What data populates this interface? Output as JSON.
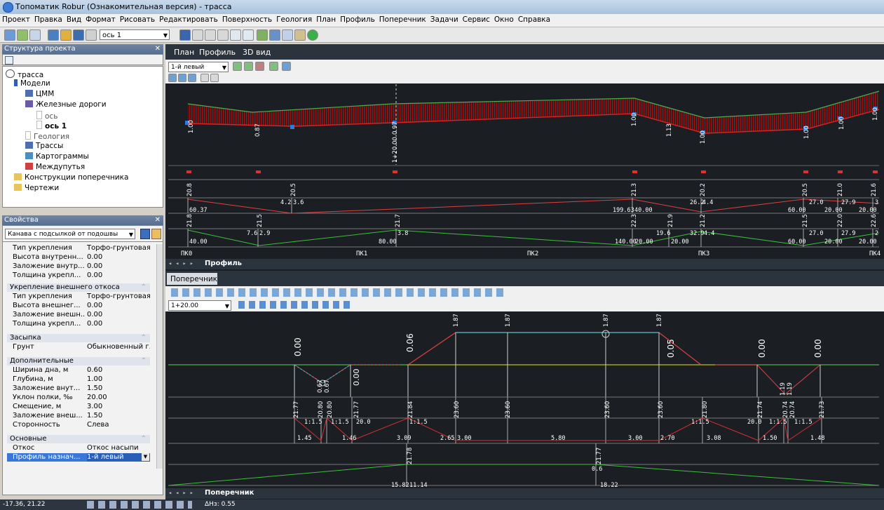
{
  "window": {
    "title": "Топоматик Robur (Ознакомительная версия) - трасса"
  },
  "menu": [
    "Проект",
    "Правка",
    "Вид",
    "Формат",
    "Рисовать",
    "Редактировать",
    "Поверхность",
    "Геология",
    "План",
    "Профиль",
    "Поперечник",
    "Задачи",
    "Сервис",
    "Окно",
    "Справка"
  ],
  "toolbar": {
    "axis_combo": "ось 1"
  },
  "project_panel": {
    "title": "Структура проекта",
    "close": "✕"
  },
  "tree": {
    "root": "трасса",
    "models": "Модели",
    "dtm": "ЦММ",
    "railways": "Железные дороги",
    "axis": "ось",
    "axis1": "ось 1",
    "geology": "Геология",
    "routes": "Трассы",
    "cartograms": "Картограммы",
    "interways": "Междупутья",
    "constructions": "Конструкции поперечника",
    "drawings": "Чертежи"
  },
  "props_panel": {
    "title": "Свойства",
    "close": "✕",
    "object_combo": "Канава с подсылкой от подошвы"
  },
  "props": {
    "r1": {
      "k": "Тип укрепления",
      "v": "Торфо-грунтовая..."
    },
    "r2": {
      "k": "Высота внутренн...",
      "v": "0.00"
    },
    "r3": {
      "k": "Заложение внутр...",
      "v": "0.00"
    },
    "r4": {
      "k": "Толщина укрепл...",
      "v": "0.00"
    },
    "s1": "Укрепление внешнего откоса",
    "r5": {
      "k": "Тип укрепления",
      "v": "Торфо-грунтовая..."
    },
    "r6": {
      "k": "Высота внешнег...",
      "v": "0.00"
    },
    "r7": {
      "k": "Заложение внешн...",
      "v": "0.00"
    },
    "r8": {
      "k": "Толщина укрепл...",
      "v": "0.00"
    },
    "s2": "Засыпка",
    "r9": {
      "k": "Грунт",
      "v": "Обыкновенный г..."
    },
    "s3": "Дополнительные",
    "r10": {
      "k": "Ширина дна, м",
      "v": "0.60"
    },
    "r11": {
      "k": "Глубина, м",
      "v": "1.00"
    },
    "r12": {
      "k": "Заложение внут...",
      "v": "1.50"
    },
    "r13": {
      "k": "Уклон полки, ‰",
      "v": "20.00"
    },
    "r14": {
      "k": "Смещение, м",
      "v": "3.00"
    },
    "r15": {
      "k": "Заложение внеш...",
      "v": "1.50"
    },
    "r16": {
      "k": "Сторонность",
      "v": "Слева"
    },
    "s4": "Основные",
    "r17": {
      "k": "Откос",
      "v": "Откос насыпи"
    },
    "r18": {
      "k": "Профиль назнач...",
      "v": "1-й левый"
    }
  },
  "view_tabs": [
    "План",
    "Профиль",
    "3D вид"
  ],
  "profile": {
    "combo": "1-й левый",
    "tab": "Профиль",
    "vert_labels": [
      "1.00",
      "0.87",
      "0.97",
      "1.00",
      "1.13",
      "1.00",
      "1.00",
      "1.00",
      "1.00"
    ],
    "station_label": "1+20.00",
    "row1": [
      "20.8",
      "20.5",
      "21.3",
      "20.2",
      "20.5",
      "21.0",
      "21.6"
    ],
    "row1_text": [
      "4.2",
      "3.6",
      "26.2",
      "4.4",
      "27.0",
      "27.9",
      "3"
    ],
    "row1_bottom": [
      "60.37",
      "199.63",
      "40.00",
      "60.00",
      "20.00",
      "20.00"
    ],
    "row2": [
      "21.8",
      "21.5",
      "21.7",
      "22.3",
      "21.9",
      "21.2",
      "21.5",
      "22.0",
      "22.6"
    ],
    "row2_text": [
      "7.6",
      "2.9",
      "3.8",
      "19.6",
      "32.9",
      "4.4",
      "27.0",
      "27.9",
      "2"
    ],
    "row2_bottom": [
      "40.00",
      "80.00",
      "140.00",
      "20.00",
      "20.00",
      "60.00",
      "20.00",
      "20.00"
    ],
    "pickets": [
      "ПК0",
      "ПК1",
      "ПК2",
      "ПК3",
      "ПК4"
    ]
  },
  "cross": {
    "tab_title": "Поперечник",
    "tab": "Поперечник",
    "combo": "1+20.00",
    "top_labels": [
      "1.87",
      "1.87",
      "1.87",
      "1.87"
    ],
    "slope_labels": [
      "0.00",
      "0.06",
      "0.05",
      "0.00",
      "0.00"
    ],
    "ditch_labels": [
      "0.67",
      "0.67",
      "0.00",
      "1.19",
      "1.19"
    ],
    "elev": [
      "21.77",
      "20.80",
      "20.80",
      "21.77",
      "21.84",
      "23.60",
      "23.60",
      "23.60",
      "23.60",
      "21.80",
      "21.74",
      "20.74",
      "20.74",
      "21.73"
    ],
    "slopes": [
      "1:1.5",
      "1:1.5",
      "20.0",
      "1:1.5",
      "1:1.5",
      "20.0",
      "1:1.5",
      "1:1.5"
    ],
    "dist": [
      "1.45",
      "1.46",
      "3.09",
      "2.65",
      "3.00",
      "5.80",
      "3.00",
      "2.70",
      "3.08",
      "1.50",
      "1.48"
    ],
    "ground_elev": [
      "21.78",
      "21.77"
    ],
    "ground_text": [
      "15.82",
      "11.14",
      "0.6",
      "18.22"
    ]
  },
  "status": {
    "coords": "-17.36, 21.22",
    "dh": "ΔHз: 0.55"
  }
}
